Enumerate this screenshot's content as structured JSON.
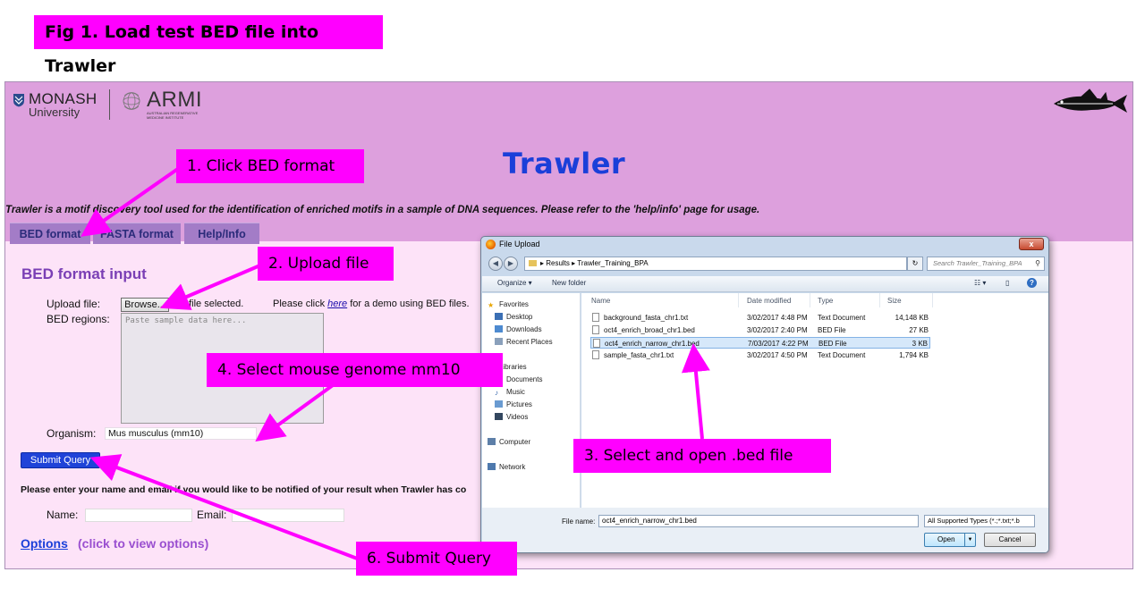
{
  "figure_title": "Fig 1. Load test  BED file into Trawler",
  "header": {
    "monash_name": "MONASH",
    "monash_university": "University",
    "armi_name": "ARMI",
    "armi_subtitle": "AUSTRALIAN REGENERATIVE MEDICINE INSTITUTE",
    "app_title": "Trawler",
    "tagline": "Trawler is a motif discovery tool used for the identification of enriched motifs in a sample of DNA sequences. Please refer to the 'help/info' page for usage."
  },
  "tabs": [
    {
      "label": "BED format"
    },
    {
      "label": "FASTA format"
    },
    {
      "label": "Help/Info"
    }
  ],
  "form": {
    "section_title": "BED format input",
    "upload_label": "Upload file:",
    "browse_label": "Browse...",
    "no_file": "No file selected.",
    "demo_note_prefix": "Please click ",
    "demo_link": "here",
    "demo_note_suffix": " for a demo using BED files.",
    "bed_regions_label": "BED regions:",
    "bed_placeholder": "Paste sample data here...",
    "organism_label": "Organism:",
    "organism_value": "Mus musculus (mm10)",
    "submit_label": "Submit Query",
    "notify_text": "Please enter your name and email if you would like to be notified of your result when Trawler has co",
    "name_label": "Name:",
    "email_label": "Email:",
    "options_link": "Options",
    "options_hint": "(click to view options)"
  },
  "dialog": {
    "title": "File Upload",
    "close_label": "x",
    "path": [
      "Results",
      "Trawler_Training_BPA"
    ],
    "path_sep": "▸",
    "search_placeholder": "Search Trawler_Training_BPA",
    "toolbar": {
      "organize": "Organize ▾",
      "new_folder": "New folder"
    },
    "nav": {
      "favorites_header": "Favorites",
      "favorites": [
        "Desktop",
        "Downloads",
        "Recent Places"
      ],
      "libraries_header": "Libraries",
      "libraries": [
        "Documents",
        "Music",
        "Pictures",
        "Videos"
      ],
      "computer": "Computer",
      "network": "Network"
    },
    "columns": {
      "name": "Name",
      "date": "Date modified",
      "type": "Type",
      "size": "Size"
    },
    "files": [
      {
        "name": "background_fasta_chr1.txt",
        "date": "3/02/2017 4:48 PM",
        "type": "Text Document",
        "size": "14,148 KB"
      },
      {
        "name": "oct4_enrich_broad_chr1.bed",
        "date": "3/02/2017 2:40 PM",
        "type": "BED File",
        "size": "27 KB"
      },
      {
        "name": "oct4_enrich_narrow_chr1.bed",
        "date": "7/03/2017 4:22 PM",
        "type": "BED File",
        "size": "3 KB"
      },
      {
        "name": "sample_fasta_chr1.txt",
        "date": "3/02/2017 4:50 PM",
        "type": "Text Document",
        "size": "1,794 KB"
      }
    ],
    "selected_file": "oct4_enrich_narrow_chr1.bed",
    "file_name_label": "File name:",
    "file_name_value": "oct4_enrich_narrow_chr1.bed",
    "file_type_value": "All Supported Types (*.;*.txt;*.b",
    "open_label": "Open",
    "cancel_label": "Cancel"
  },
  "callouts": {
    "step1": "1. Click BED format",
    "step2": "2. Upload file",
    "step3": "3. Select and open .bed file",
    "step4": "4. Select mouse genome mm10",
    "step6": "6. Submit Query"
  },
  "colors": {
    "annotation_magenta": "#ff00ff",
    "header_band": "#dda0dd",
    "title_blue": "#1a3fd9",
    "tab_purple": "#a37cc7"
  }
}
